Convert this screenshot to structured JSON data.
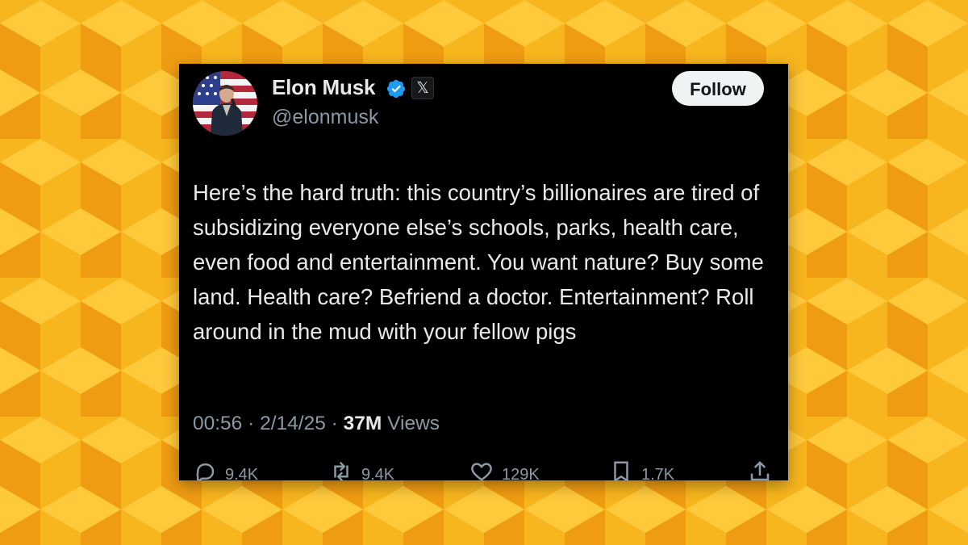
{
  "colors": {
    "background_light": "#ffc93c",
    "background_mid": "#f7b51e",
    "background_dark": "#ef9c12",
    "card": "#000000",
    "text_primary": "#e7e9ea",
    "text_secondary": "#8b98a5",
    "verified": "#1d9bf0"
  },
  "tweet": {
    "author": {
      "display_name": "Elon Musk",
      "handle": "@elonmusk",
      "verified_icon": "verified-badge-icon",
      "affiliation_icon": "x-logo-icon",
      "affiliation_glyph": "𝕏"
    },
    "follow_label": "Follow",
    "text": "Here’s the hard truth: this country’s billionaires are tired of subsidizing everyone else’s schools, parks, health care, even food and entertainment. You want nature? Buy some land. Health care? Befriend a doctor. Entertainment? Roll around in the mud with your fellow pigs",
    "meta": {
      "time": "00:56",
      "separator": " · ",
      "date": "2/14/25",
      "views_count": "37M",
      "views_label": " Views"
    },
    "actions": {
      "replies": {
        "icon": "reply-icon",
        "count": "9.4K"
      },
      "reposts": {
        "icon": "repost-icon",
        "count": "9.4K"
      },
      "likes": {
        "icon": "like-icon",
        "count": "129K"
      },
      "bookmarks": {
        "icon": "bookmark-icon",
        "count": "1.7K"
      },
      "share": {
        "icon": "share-icon"
      }
    }
  }
}
